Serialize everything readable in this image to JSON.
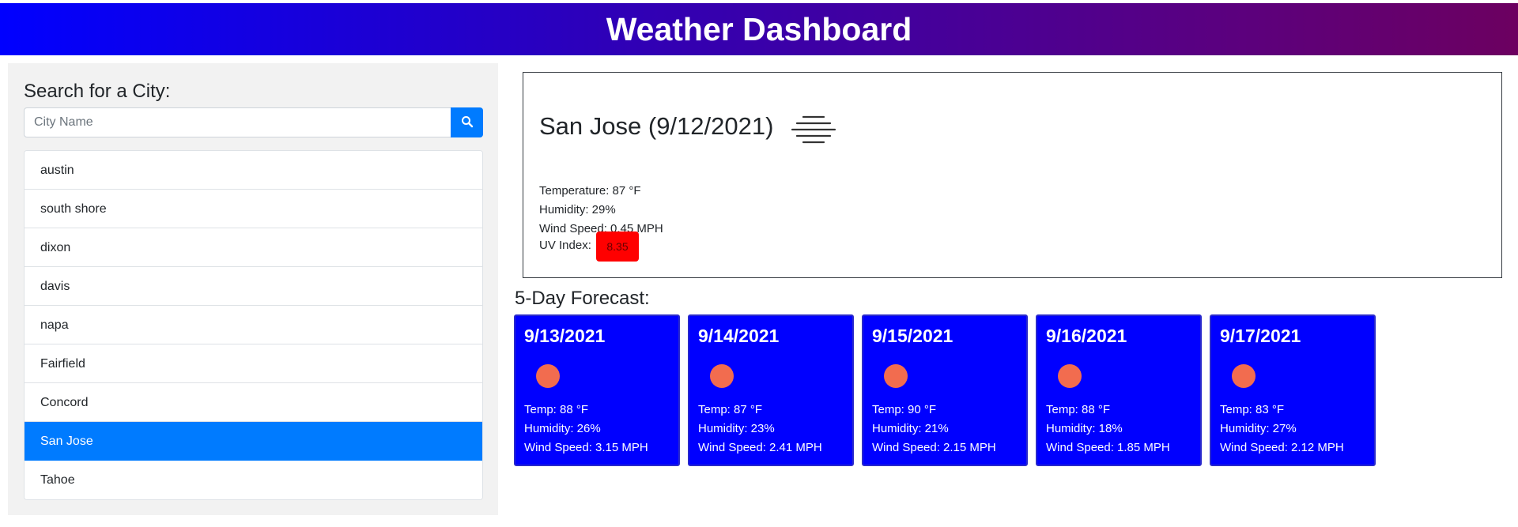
{
  "header": {
    "title": "Weather Dashboard"
  },
  "sidebar": {
    "search_title": "Search for a City:",
    "search_placeholder": "City Name",
    "search_icon": "search-icon",
    "cities": [
      "austin",
      "south shore",
      "dixon",
      "davis",
      "napa",
      "Fairfield",
      "Concord",
      "San Jose",
      "Tahoe"
    ],
    "active_city": "San Jose"
  },
  "current": {
    "title": "San Jose (9/12/2021)",
    "icon": "fog-icon",
    "temperature": "Temperature: 87 °F",
    "humidity": "Humidity: 29%",
    "wind": "Wind Speed: 0.45 MPH",
    "uv_label": "UV Index:",
    "uv_value": "8.35"
  },
  "forecast": {
    "title": "5-Day Forecast:",
    "days": [
      {
        "date": "9/13/2021",
        "icon": "sun-icon",
        "temp": "Temp: 88 °F",
        "humidity": "Humidity: 26%",
        "wind": "Wind Speed: 3.15 MPH"
      },
      {
        "date": "9/14/2021",
        "icon": "sun-icon",
        "temp": "Temp: 87 °F",
        "humidity": "Humidity: 23%",
        "wind": "Wind Speed: 2.41 MPH"
      },
      {
        "date": "9/15/2021",
        "icon": "sun-icon",
        "temp": "Temp: 90 °F",
        "humidity": "Humidity: 21%",
        "wind": "Wind Speed: 2.15 MPH"
      },
      {
        "date": "9/16/2021",
        "icon": "sun-icon",
        "temp": "Temp: 88 °F",
        "humidity": "Humidity: 18%",
        "wind": "Wind Speed: 1.85 MPH"
      },
      {
        "date": "9/17/2021",
        "icon": "sun-icon",
        "temp": "Temp: 83 °F",
        "humidity": "Humidity: 27%",
        "wind": "Wind Speed: 2.12 MPH"
      }
    ]
  },
  "colors": {
    "header_gradient_start": "#0000ff",
    "header_gradient_end": "#6c0060",
    "accent": "#007bff",
    "forecast_card": "#0000ff",
    "uv_severe": "#ff0000",
    "sun": "#f26c4f"
  }
}
